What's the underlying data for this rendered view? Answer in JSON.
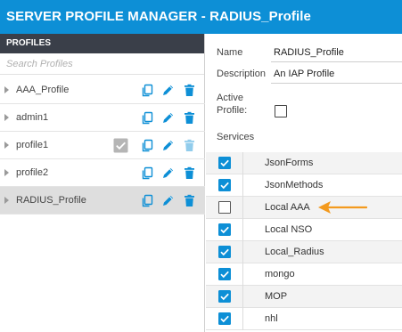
{
  "title": "SERVER PROFILE MANAGER - RADIUS_Profile",
  "sidebar": {
    "header": "PROFILES",
    "search_placeholder": "Search Profiles",
    "profiles": [
      {
        "label": "AAA_Profile",
        "selected": false,
        "active": false
      },
      {
        "label": "admin1",
        "selected": false,
        "active": false
      },
      {
        "label": "profile1",
        "selected": false,
        "active": true
      },
      {
        "label": "profile2",
        "selected": false,
        "active": false
      },
      {
        "label": "RADIUS_Profile",
        "selected": true,
        "active": false
      }
    ],
    "icons": {
      "copy": "copy-icon",
      "edit": "pencil-icon",
      "delete": "trash-icon",
      "active": "check-icon"
    }
  },
  "form": {
    "name_label": "Name",
    "name_value": "RADIUS_Profile",
    "description_label": "Description",
    "description_value": "An IAP Profile",
    "active_label_line1": "Active",
    "active_label_line2": "Profile:",
    "active_checked": false,
    "services_label": "Services"
  },
  "services": [
    {
      "label": "JsonForms",
      "checked": true
    },
    {
      "label": "JsonMethods",
      "checked": true
    },
    {
      "label": "Local AAA",
      "checked": false
    },
    {
      "label": "Local NSO",
      "checked": true
    },
    {
      "label": "Local_Radius",
      "checked": true
    },
    {
      "label": "mongo",
      "checked": true
    },
    {
      "label": "MOP",
      "checked": true
    },
    {
      "label": "nhl",
      "checked": true
    }
  ],
  "colors": {
    "accent": "#0d8fd6",
    "sidebar_header": "#3a3f49",
    "selected_row": "#dedede",
    "checkbox_blue": "#0d8fd6",
    "annotation_arrow": "#f39a1e",
    "disabled_grey": "#b5b5b5"
  }
}
